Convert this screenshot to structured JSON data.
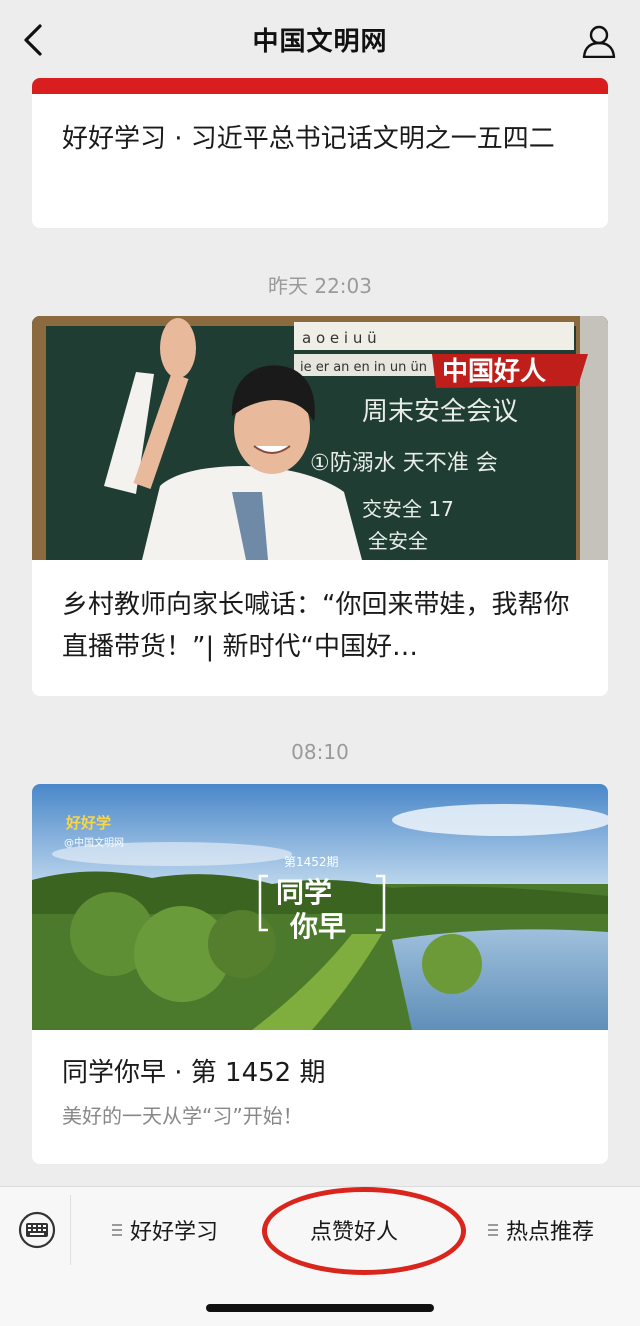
{
  "header": {
    "title": "中国文明网",
    "back_icon": "back-chevron-icon",
    "user_icon": "user-icon"
  },
  "feed": {
    "card1": {
      "title": "好好学习 · 习近平总书记话文明之一五四二"
    },
    "timestamp2": "昨天 22:03",
    "card2": {
      "title": "乡村教师向家长喊话：“你回来带娃，我帮你直播带货！”| 新时代“中国好…",
      "image": {
        "badge": "中国好人",
        "board_text_1": "周末安全会议",
        "board_text_2": "①防溺水 天不准 会",
        "board_text_3": "交安全 17",
        "board_text_4": "全安全",
        "pinyin_row_1": "a o e i u ü",
        "pinyin_row_2": "ie er an en in un ün"
      }
    },
    "timestamp3": "08:10",
    "card3": {
      "title": "同学你早 · 第 1452 期",
      "subtitle": "美好的一天从学“习”开始！",
      "image": {
        "logo": "好好学",
        "logo_sub": "@中国文明网",
        "issue": "第1452期",
        "overlay_1": "同学",
        "overlay_2": "你早"
      }
    }
  },
  "menu": {
    "keyboard_icon": "keyboard-icon",
    "items": [
      {
        "label": "好好学习"
      },
      {
        "label": "点赞好人"
      },
      {
        "label": "热点推荐"
      }
    ],
    "highlight_color": "#d9251c"
  },
  "colors": {
    "accent_red": "#d81e1e",
    "background": "#ededed"
  }
}
